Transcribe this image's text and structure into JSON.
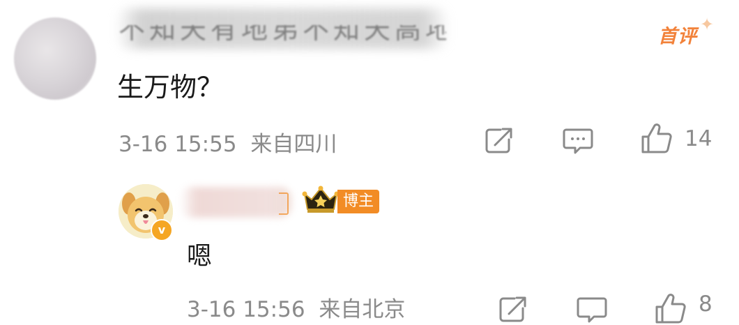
{
  "comments": [
    {
      "user_name": "不知天有地弟不知天高地厚",
      "badge": "首评",
      "text": "生万物？",
      "date": "3-16 15:55",
      "location": "来自四川",
      "likes": "14"
    }
  ],
  "reply": {
    "user_name": "",
    "role_tag": "博主",
    "verified_mark": "v",
    "text": "嗯",
    "date": "3-16 15:56",
    "location": "来自北京",
    "likes": "8"
  },
  "colors": {
    "badge_orange": "#f2823a",
    "tag_orange": "#f28c25",
    "meta_gray": "#8a8a8a"
  },
  "icons": [
    "share-icon",
    "comment-icon",
    "like-icon",
    "crown-icon"
  ]
}
